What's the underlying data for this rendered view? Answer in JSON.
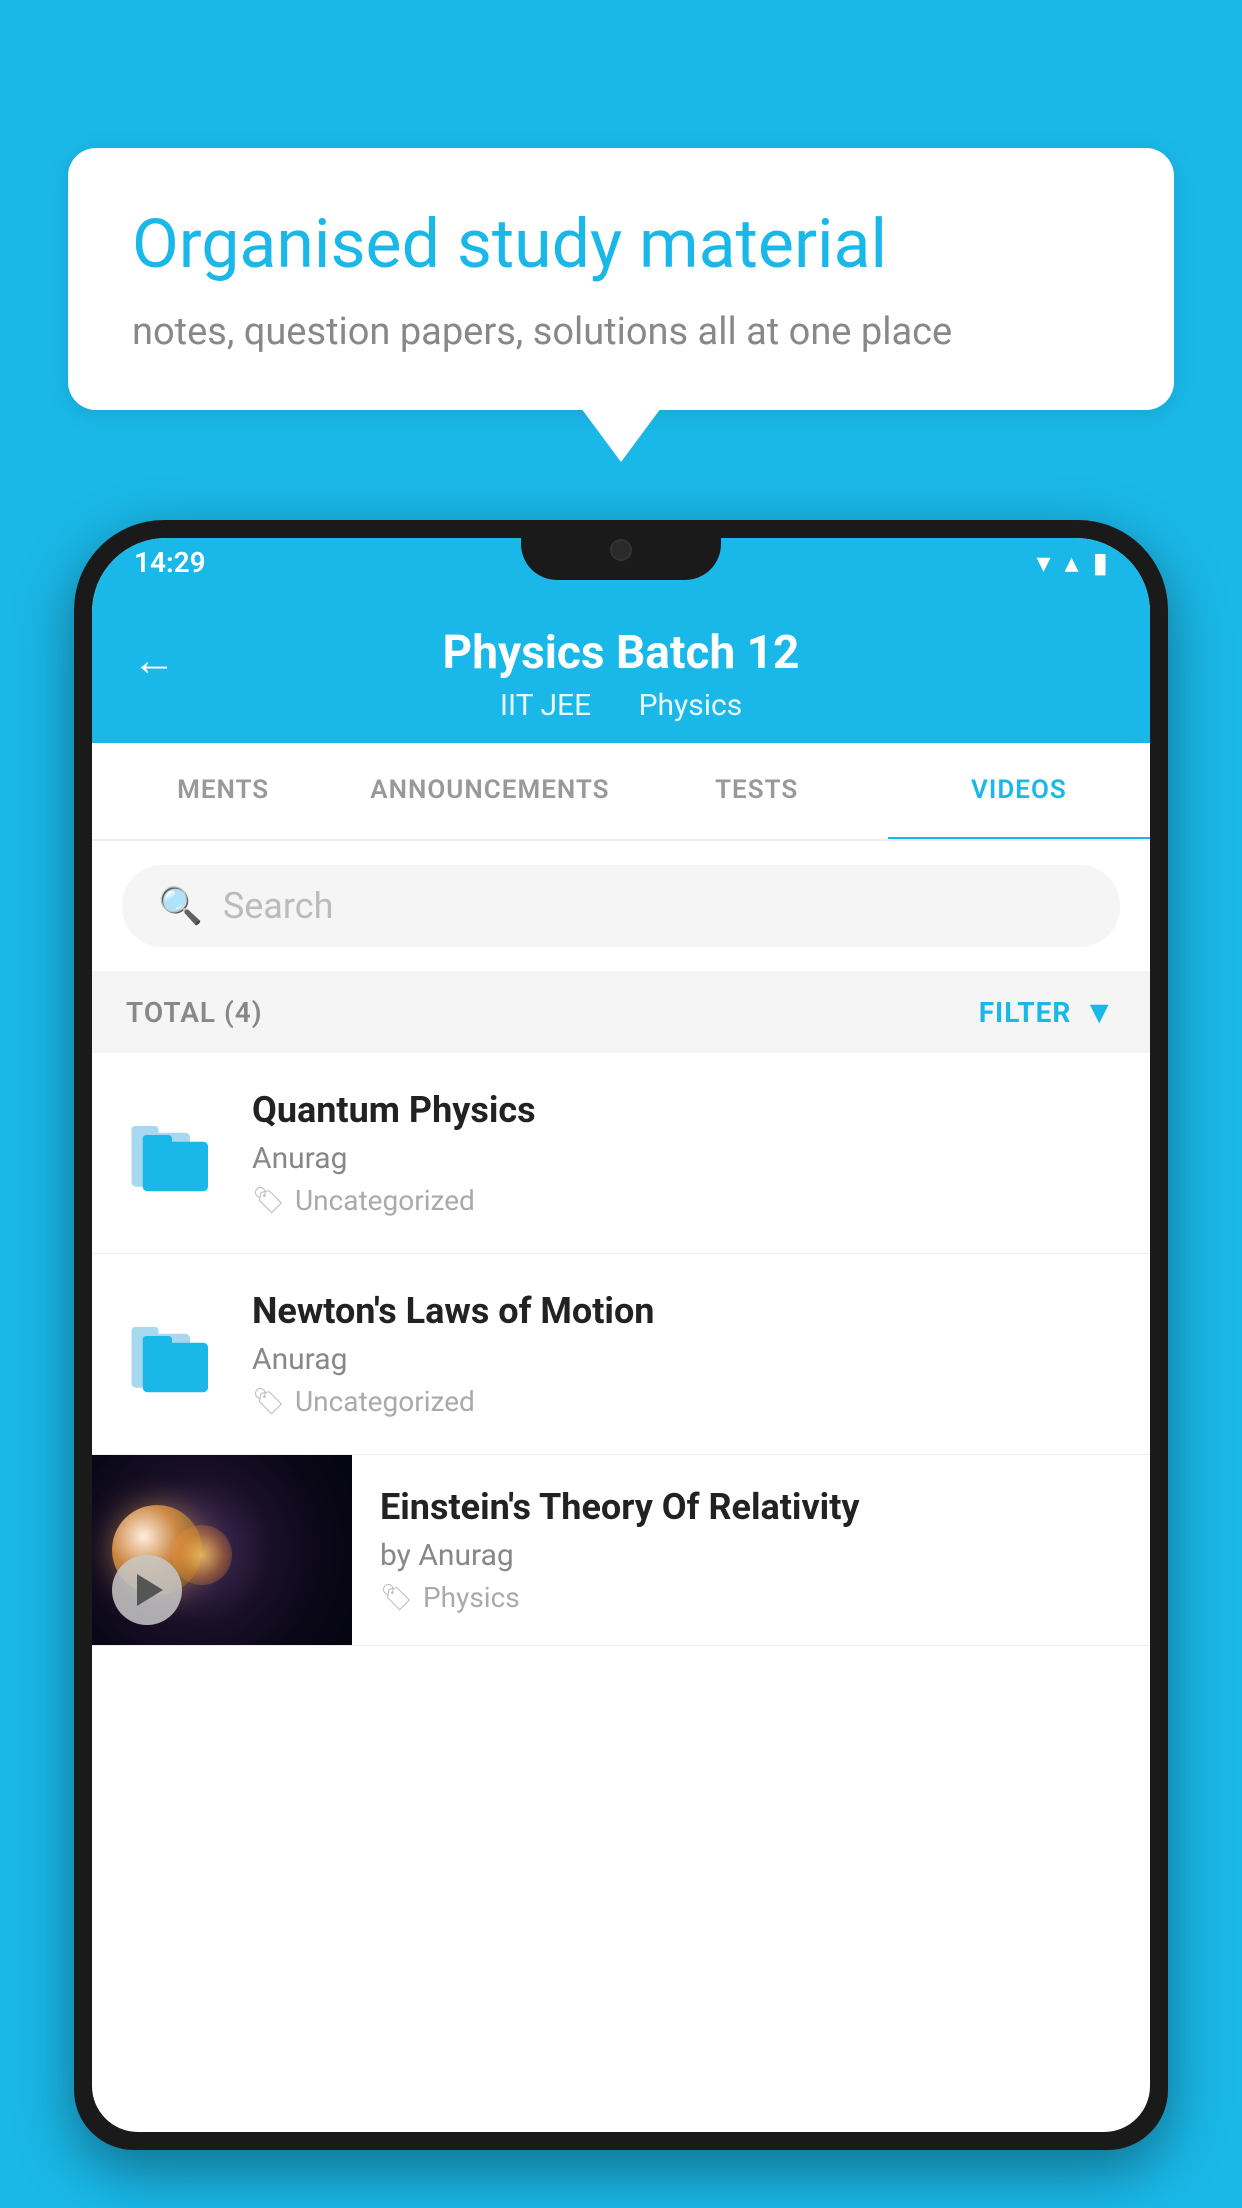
{
  "background_color": "#1ab8e8",
  "speech_bubble": {
    "title": "Organised study material",
    "subtitle": "notes, question papers, solutions all at one place"
  },
  "status_bar": {
    "time": "14:29",
    "wifi": "▾",
    "signal": "▴",
    "battery": "▮"
  },
  "app_header": {
    "title": "Physics Batch 12",
    "subtitle_left": "IIT JEE",
    "subtitle_right": "Physics",
    "back_label": "←"
  },
  "tabs": [
    {
      "label": "MENTS",
      "active": false
    },
    {
      "label": "ANNOUNCEMENTS",
      "active": false
    },
    {
      "label": "TESTS",
      "active": false
    },
    {
      "label": "VIDEOS",
      "active": true
    }
  ],
  "search": {
    "placeholder": "Search"
  },
  "filter_row": {
    "total_label": "TOTAL (4)",
    "filter_label": "FILTER"
  },
  "videos": [
    {
      "id": 1,
      "title": "Quantum Physics",
      "author": "Anurag",
      "category": "Uncategorized",
      "type": "folder"
    },
    {
      "id": 2,
      "title": "Newton's Laws of Motion",
      "author": "Anurag",
      "category": "Uncategorized",
      "type": "folder"
    },
    {
      "id": 3,
      "title": "Einstein's Theory Of Relativity",
      "author": "by Anurag",
      "category": "Physics",
      "type": "thumbnail"
    }
  ]
}
